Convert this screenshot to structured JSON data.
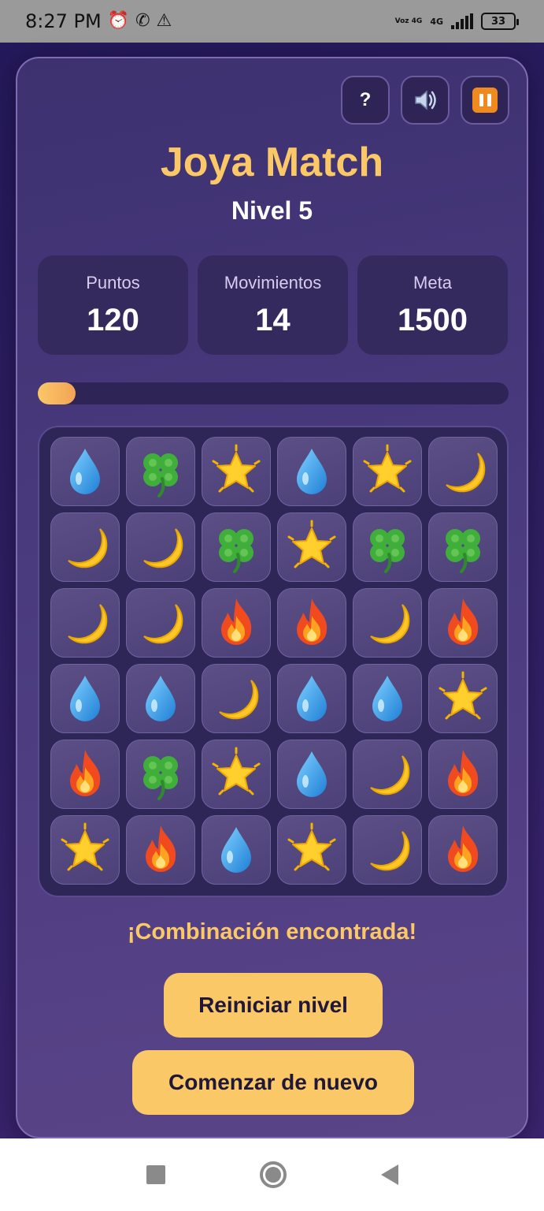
{
  "status_bar": {
    "time": "8:27 PM",
    "network": "Voz 4G",
    "network_type": "4G",
    "battery": "33",
    "icons": [
      "alarm-icon",
      "whatsapp-icon",
      "warning-icon",
      "signal-icon",
      "battery-icon"
    ]
  },
  "game": {
    "title": "Joya Match",
    "level": "Nivel 5",
    "buttons": {
      "help": "?",
      "sound": "speaker-icon",
      "pause": "pause-icon"
    },
    "stats": [
      {
        "label": "Puntos",
        "value": "120"
      },
      {
        "label": "Movimientos",
        "value": "14"
      },
      {
        "label": "Meta",
        "value": "1500"
      }
    ],
    "progress": 0.08,
    "board": [
      [
        "drop",
        "clover",
        "star",
        "drop",
        "star",
        "moon"
      ],
      [
        "moon",
        "moon",
        "clover",
        "star",
        "clover",
        "clover"
      ],
      [
        "moon",
        "moon",
        "fire",
        "fire",
        "moon",
        "fire"
      ],
      [
        "drop",
        "drop",
        "moon",
        "drop",
        "drop",
        "star"
      ],
      [
        "fire",
        "clover",
        "star",
        "drop",
        "moon",
        "fire"
      ],
      [
        "star",
        "fire",
        "drop",
        "star",
        "moon",
        "fire"
      ]
    ],
    "message": "¡Combinación encontrada!",
    "restart_label": "Reiniciar nivel",
    "new_game_label": "Comenzar de nuevo"
  },
  "colors": {
    "accent": "#fbc867",
    "card_bg": "#4a3a7e",
    "tile_bg": "#5b4f86",
    "pause_orange": "#f08a1f"
  }
}
